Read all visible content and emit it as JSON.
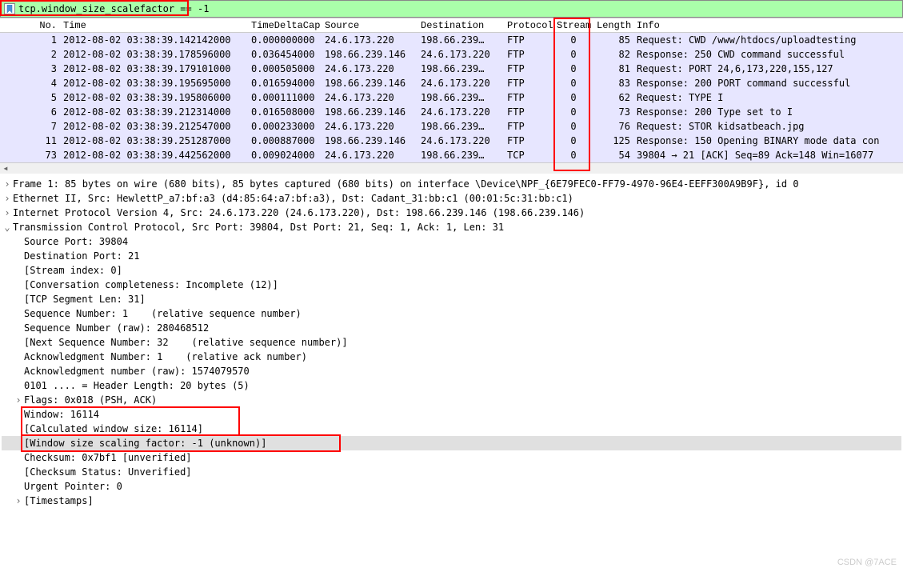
{
  "filter": {
    "text": "tcp.window_size_scalefactor == -1"
  },
  "columns": {
    "no": "No.",
    "time": "Time",
    "delta": "TimeDeltaCap",
    "src": "Source",
    "dst": "Destination",
    "proto": "Protocol",
    "stream": "Stream",
    "len": "Length",
    "info": "Info"
  },
  "packets": [
    {
      "no": "1",
      "time": "2012-08-02 03:38:39.142142000",
      "delta": "0.000000000",
      "src": "24.6.173.220",
      "dst": "198.66.239…",
      "proto": "FTP",
      "stream": "0",
      "len": "85",
      "info": "Request: CWD /www/htdocs/uploadtesting"
    },
    {
      "no": "2",
      "time": "2012-08-02 03:38:39.178596000",
      "delta": "0.036454000",
      "src": "198.66.239.146",
      "dst": "24.6.173.220",
      "proto": "FTP",
      "stream": "0",
      "len": "82",
      "info": "Response: 250 CWD command successful"
    },
    {
      "no": "3",
      "time": "2012-08-02 03:38:39.179101000",
      "delta": "0.000505000",
      "src": "24.6.173.220",
      "dst": "198.66.239…",
      "proto": "FTP",
      "stream": "0",
      "len": "81",
      "info": "Request: PORT 24,6,173,220,155,127"
    },
    {
      "no": "4",
      "time": "2012-08-02 03:38:39.195695000",
      "delta": "0.016594000",
      "src": "198.66.239.146",
      "dst": "24.6.173.220",
      "proto": "FTP",
      "stream": "0",
      "len": "83",
      "info": "Response: 200 PORT command successful"
    },
    {
      "no": "5",
      "time": "2012-08-02 03:38:39.195806000",
      "delta": "0.000111000",
      "src": "24.6.173.220",
      "dst": "198.66.239…",
      "proto": "FTP",
      "stream": "0",
      "len": "62",
      "info": "Request: TYPE I"
    },
    {
      "no": "6",
      "time": "2012-08-02 03:38:39.212314000",
      "delta": "0.016508000",
      "src": "198.66.239.146",
      "dst": "24.6.173.220",
      "proto": "FTP",
      "stream": "0",
      "len": "73",
      "info": "Response: 200 Type set to I"
    },
    {
      "no": "7",
      "time": "2012-08-02 03:38:39.212547000",
      "delta": "0.000233000",
      "src": "24.6.173.220",
      "dst": "198.66.239…",
      "proto": "FTP",
      "stream": "0",
      "len": "76",
      "info": "Request: STOR kidsatbeach.jpg"
    },
    {
      "no": "11",
      "time": "2012-08-02 03:38:39.251287000",
      "delta": "0.000887000",
      "src": "198.66.239.146",
      "dst": "24.6.173.220",
      "proto": "FTP",
      "stream": "0",
      "len": "125",
      "info": "Response: 150 Opening BINARY mode data con"
    },
    {
      "no": "73",
      "time": "2012-08-02 03:38:39.442562000",
      "delta": "0.009024000",
      "src": "24.6.173.220",
      "dst": "198.66.239…",
      "proto": "TCP",
      "stream": "0",
      "len": "54",
      "info": "39804 → 21 [ACK] Seq=89 Ack=148 Win=16077"
    }
  ],
  "details": {
    "frame": "Frame 1: 85 bytes on wire (680 bits), 85 bytes captured (680 bits) on interface \\Device\\NPF_{6E79FEC0-FF79-4970-96E4-EEFF300A9B9F}, id 0",
    "eth": "Ethernet II, Src: HewlettP_a7:bf:a3 (d4:85:64:a7:bf:a3), Dst: Cadant_31:bb:c1 (00:01:5c:31:bb:c1)",
    "ip": "Internet Protocol Version 4, Src: 24.6.173.220 (24.6.173.220), Dst: 198.66.239.146 (198.66.239.146)",
    "tcp": "Transmission Control Protocol, Src Port: 39804, Dst Port: 21, Seq: 1, Ack: 1, Len: 31",
    "tcp_fields": {
      "srcport": "Source Port: 39804",
      "dstport": "Destination Port: 21",
      "streamidx": "[Stream index: 0]",
      "convcomp": "[Conversation completeness: Incomplete (12)]",
      "seglen": "[TCP Segment Len: 31]",
      "seqnum": "Sequence Number: 1    (relative sequence number)",
      "seqraw": "Sequence Number (raw): 280468512",
      "nextseq": "[Next Sequence Number: 32    (relative sequence number)]",
      "acknum": "Acknowledgment Number: 1    (relative ack number)",
      "ackraw": "Acknowledgment number (raw): 1574079570",
      "hdrlen": "0101 .... = Header Length: 20 bytes (5)",
      "flags": "Flags: 0x018 (PSH, ACK)",
      "window": "Window: 16114",
      "calcwin": "[Calculated window size: 16114]",
      "winscale": "[Window size scaling factor: -1 (unknown)]",
      "checksum": "Checksum: 0x7bf1 [unverified]",
      "chkstatus": "[Checksum Status: Unverified]",
      "urgent": "Urgent Pointer: 0",
      "timestamps": "[Timestamps]"
    }
  },
  "watermark": "CSDN @7ACE"
}
